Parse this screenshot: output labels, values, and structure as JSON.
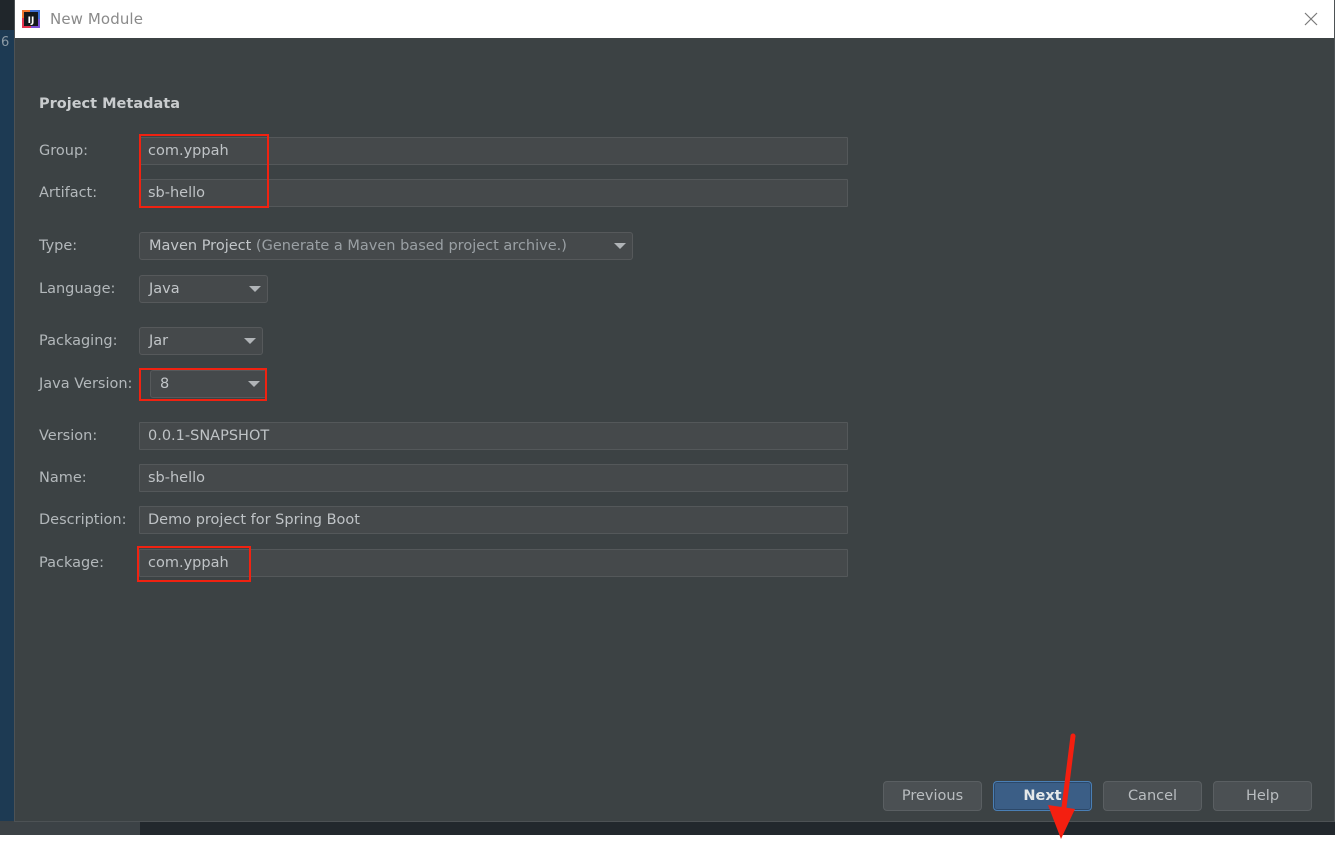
{
  "backdrop": {
    "line_number": "6"
  },
  "titlebar": {
    "title": "New Module",
    "app_icon": "intellij-idea-icon",
    "close_icon": "close-icon"
  },
  "dialog": {
    "section_title": "Project Metadata",
    "fields": [
      {
        "label": "Group:",
        "value": "com.yppah",
        "kind": "text"
      },
      {
        "label": "Artifact:",
        "value": "sb-hello",
        "kind": "text"
      },
      {
        "label": "Type:",
        "value": "Maven Project",
        "hint": " (Generate a Maven based project archive.)",
        "kind": "combo"
      },
      {
        "label": "Language:",
        "value": "Java",
        "kind": "combo"
      },
      {
        "label": "Packaging:",
        "value": "Jar",
        "kind": "combo"
      },
      {
        "label": "Java Version:",
        "value": "8",
        "kind": "combo"
      },
      {
        "label": "Version:",
        "value": "0.0.1-SNAPSHOT",
        "kind": "text"
      },
      {
        "label": "Name:",
        "value": "sb-hello",
        "kind": "text"
      },
      {
        "label": "Description:",
        "value": "Demo project for Spring Boot",
        "kind": "text"
      },
      {
        "label": "Package:",
        "value": "com.yppah",
        "kind": "text"
      }
    ]
  },
  "footer": {
    "previous_label": "Previous",
    "next_label": "Next",
    "cancel_label": "Cancel",
    "help_label": "Help"
  },
  "annotations": {
    "color": "#f02211",
    "arrow": "red-arrow-pointing-to-next-button",
    "boxes": [
      "group-and-artifact-fields",
      "java-version-dropdown",
      "package-field"
    ]
  }
}
